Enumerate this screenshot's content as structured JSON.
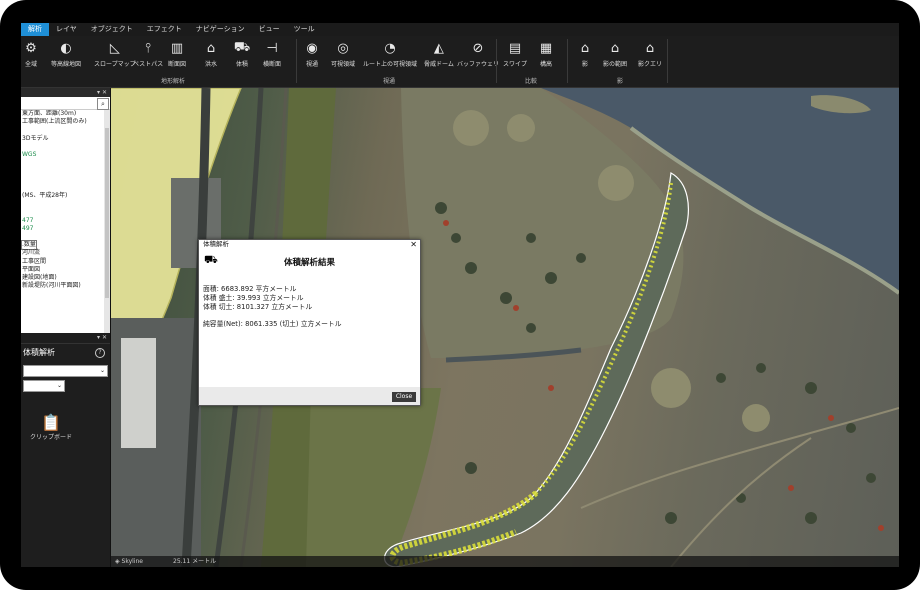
{
  "menu": [
    "解析",
    "レイヤ",
    "オブジェクト",
    "エフェクト",
    "ナビゲーション",
    "ビュー",
    "ツール"
  ],
  "ribbon": {
    "buttons": [
      {
        "label": "全域",
        "icon": "gear-icon"
      },
      {
        "label": "等高線地図",
        "icon": "contour-icon"
      },
      {
        "label": "スロープマップ",
        "icon": "slope-icon"
      },
      {
        "label": "ベストパス",
        "icon": "best-path-icon"
      },
      {
        "label": "断面図",
        "icon": "profile-icon"
      },
      {
        "label": "洪水",
        "icon": "flood-icon"
      },
      {
        "label": "体積",
        "icon": "volume-icon"
      },
      {
        "label": "横断面",
        "icon": "cross-section-icon"
      },
      {
        "label": "視通",
        "icon": "line-of-sight-icon"
      },
      {
        "label": "可視領域",
        "icon": "viewshed-icon"
      },
      {
        "label": "ルート上の可視領域",
        "icon": "route-viewshed-icon"
      },
      {
        "label": "脅威ドーム",
        "icon": "threat-dome-icon"
      },
      {
        "label": "バッファウェリ",
        "icon": "buffer-icon"
      },
      {
        "label": "スワイプ",
        "icon": "swipe-icon"
      },
      {
        "label": "構高",
        "icon": "building-height-icon"
      },
      {
        "label": "影",
        "icon": "shadow-icon"
      },
      {
        "label": "影の範囲",
        "icon": "shadow-range-icon"
      },
      {
        "label": "影クエリ",
        "icon": "shadow-query-icon"
      }
    ],
    "groups": {
      "terrain": "地形解析",
      "visibility": "視通",
      "compare": "比較",
      "shadow": "影"
    }
  },
  "left_panel": {
    "tree_lines": [
      "東方面、距離(30m)",
      "工事範囲(上流区間のみ)",
      "",
      "3Dモデル",
      "",
      "WGS",
      "",
      "",
      "",
      "",
      "(MS、平成28年)",
      "",
      "",
      "477",
      "497",
      "",
      ".数量",
      "河川流",
      "工事区間",
      "平面図",
      "建設図(地面)",
      "新設堤防(河川平面図)",
      "",
      "",
      ""
    ],
    "tool_title": "体積解析",
    "clipboard_label": "クリップボード"
  },
  "dialog": {
    "window_title": "体積解析",
    "heading": "体積解析結果",
    "area_line": "面積: 6683.892 平方メートル",
    "fill_line": "体積 盛土: 39.993 立方メートル",
    "cut_line": "体積 切土: 8101.327 立方メートル",
    "net_line": "純容量(Net): 8061.335 (切土) 立方メートル",
    "close_label": "Close"
  },
  "status": {
    "scale": "25.11 メートル",
    "brand": "Skyline"
  }
}
